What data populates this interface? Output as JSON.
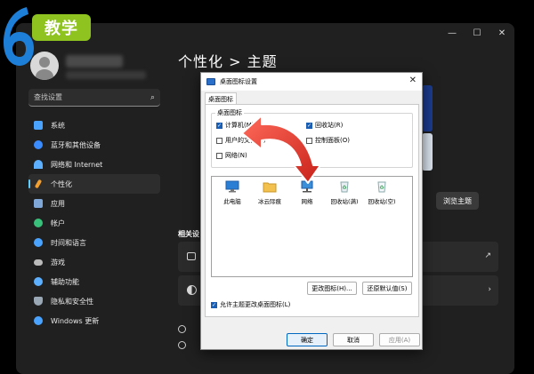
{
  "logo": {
    "digit": "6",
    "badge": "教学"
  },
  "settings": {
    "search_placeholder": "查找设置",
    "page_title": "个性化 > 主题",
    "nav": [
      {
        "label": "系统",
        "icon": "monitor-icon",
        "color": "#4aa3ff"
      },
      {
        "label": "蓝牙和其他设备",
        "icon": "bluetooth-icon",
        "color": "#3b8cff"
      },
      {
        "label": "网络和 Internet",
        "icon": "wifi-icon",
        "color": "#5db0ff"
      },
      {
        "label": "个性化",
        "icon": "brush-icon",
        "color": "#f0a030"
      },
      {
        "label": "应用",
        "icon": "apps-icon",
        "color": "#7fa7d8"
      },
      {
        "label": "帐户",
        "icon": "person-icon",
        "color": "#39c07a"
      },
      {
        "label": "时间和语言",
        "icon": "globe-icon",
        "color": "#4aa3ff"
      },
      {
        "label": "游戏",
        "icon": "gamepad-icon",
        "color": "#bbbbbb"
      },
      {
        "label": "辅助功能",
        "icon": "accessibility-icon",
        "color": "#5db0ff"
      },
      {
        "label": "隐私和安全性",
        "icon": "shield-icon",
        "color": "#9aa7b5"
      },
      {
        "label": "Windows 更新",
        "icon": "update-icon",
        "color": "#4aa3ff"
      }
    ],
    "active_index": 3,
    "browse_button": "浏览主题",
    "related_heading": "相关设"
  },
  "dialog": {
    "title": "桌面图标设置",
    "tab": "桌面图标",
    "group_label": "桌面图标",
    "checkboxes": [
      {
        "label": "计算机(M)",
        "checked": true
      },
      {
        "label": "回收站(R)",
        "checked": true
      },
      {
        "label": "用户的文件(U)",
        "checked": false
      },
      {
        "label": "控制面板(O)",
        "checked": false
      },
      {
        "label": "网络(N)",
        "checked": false
      }
    ],
    "icons": [
      {
        "label": "此电脑",
        "icon": "computer-icon"
      },
      {
        "label": "冰云际痕",
        "icon": "folder-icon"
      },
      {
        "label": "网络",
        "icon": "network-icon"
      },
      {
        "label": "回收站(满)",
        "icon": "recycle-bin-full-icon"
      },
      {
        "label": "回收站(空)",
        "icon": "recycle-bin-empty-icon"
      }
    ],
    "change_icon_button": "更改图标(H)...",
    "restore_default_button": "还原默认值(S)",
    "allow_themes_label": "允许主题更改桌面图标(L)",
    "allow_themes_checked": true,
    "ok_button": "确定",
    "cancel_button": "取消",
    "apply_button": "应用(A)"
  }
}
